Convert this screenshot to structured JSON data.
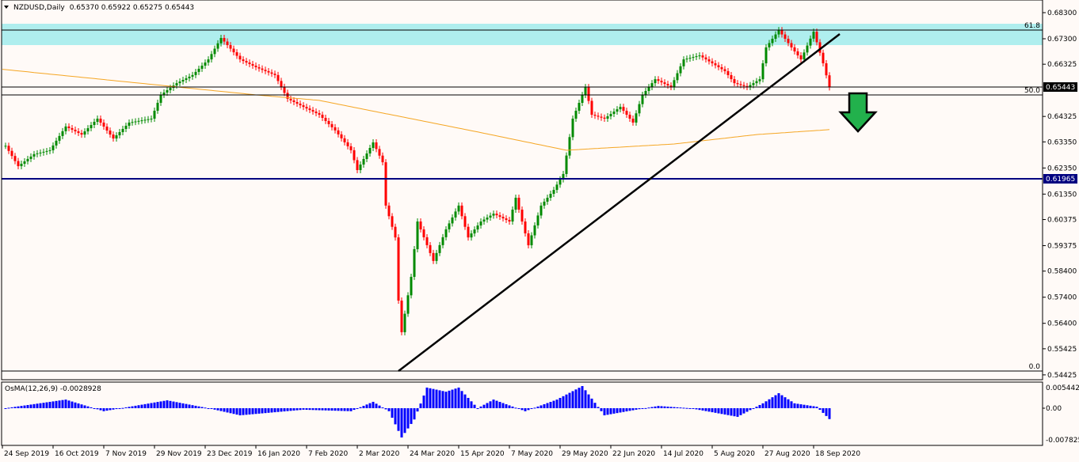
{
  "header": {
    "symbol_timeframe": "NZDUSD,Daily",
    "ohlc": "0.65370 0.65922 0.65275 0.65443"
  },
  "colors": {
    "bull": "#008a00",
    "bear": "#ff0000",
    "ma": "#f5a623",
    "zone": "#afeeee",
    "support": "#000080",
    "histogram": "#0000ff",
    "arrow": "#22b14c",
    "background": "#fffaf7"
  },
  "price_axis": {
    "ticks": [
      "0.68300",
      "0.67300",
      "0.66325",
      "0.64325",
      "0.63350",
      "0.62350",
      "0.61350",
      "0.60375",
      "0.59375",
      "0.58400",
      "0.57400",
      "0.56400",
      "0.55425",
      "0.54425"
    ],
    "current_price": "0.65443",
    "support_price": "0.61965"
  },
  "fibonacci": [
    {
      "label": "61.8",
      "price": 0.6739
    },
    {
      "label": "50.0",
      "price": 0.6515
    },
    {
      "label": "0.0",
      "price": 0.5451
    }
  ],
  "indicator": {
    "title": "OsMA(12,26,9) -0.0028928",
    "axis": [
      "0.0054422",
      "0.00",
      "-0.007825"
    ]
  },
  "time_axis": [
    "24 Sep 2019",
    "16 Oct 2019",
    "7 Nov 2019",
    "29 Nov 2019",
    "23 Dec 2019",
    "16 Jan 2020",
    "7 Feb 2020",
    "2 Mar 2020",
    "24 Mar 2020",
    "15 Apr 2020",
    "7 May 2020",
    "29 May 2020",
    "22 Jun 2020",
    "14 Jul 2020",
    "5 Aug 2020",
    "27 Aug 2020",
    "18 Sep 2020"
  ],
  "chart_data": {
    "type": "candlestick",
    "title": "NZDUSD,Daily",
    "ylim": [
      0.54425,
      0.683
    ],
    "close_keypoints_bar_price": [
      [
        1,
        0.632
      ],
      [
        5,
        0.6242
      ],
      [
        10,
        0.6288
      ],
      [
        15,
        0.6303
      ],
      [
        20,
        0.6394
      ],
      [
        25,
        0.6363
      ],
      [
        30,
        0.6424
      ],
      [
        35,
        0.6348
      ],
      [
        40,
        0.6409
      ],
      [
        47,
        0.6424
      ],
      [
        50,
        0.6515
      ],
      [
        55,
        0.656
      ],
      [
        60,
        0.6591
      ],
      [
        65,
        0.6651
      ],
      [
        69,
        0.6733
      ],
      [
        75,
        0.6651
      ],
      [
        80,
        0.6621
      ],
      [
        86,
        0.6591
      ],
      [
        90,
        0.65
      ],
      [
        95,
        0.6469
      ],
      [
        100,
        0.6439
      ],
      [
        105,
        0.6379
      ],
      [
        110,
        0.6303
      ],
      [
        112,
        0.6227
      ],
      [
        117,
        0.6333
      ],
      [
        120,
        0.6257
      ],
      [
        121,
        0.6091
      ],
      [
        124,
        0.5969
      ],
      [
        125,
        0.5727
      ],
      [
        126,
        0.5606
      ],
      [
        129,
        0.5818
      ],
      [
        131,
        0.603
      ],
      [
        136,
        0.5879
      ],
      [
        140,
        0.6
      ],
      [
        144,
        0.6091
      ],
      [
        147,
        0.5969
      ],
      [
        151,
        0.603
      ],
      [
        155,
        0.606
      ],
      [
        160,
        0.603
      ],
      [
        162,
        0.6121
      ],
      [
        166,
        0.5939
      ],
      [
        170,
        0.6091
      ],
      [
        174,
        0.6151
      ],
      [
        177,
        0.6212
      ],
      [
        180,
        0.6424
      ],
      [
        184,
        0.6545
      ],
      [
        186,
        0.6439
      ],
      [
        190,
        0.6424
      ],
      [
        195,
        0.6469
      ],
      [
        199,
        0.6409
      ],
      [
        202,
        0.6515
      ],
      [
        206,
        0.6575
      ],
      [
        211,
        0.6545
      ],
      [
        215,
        0.6651
      ],
      [
        220,
        0.6666
      ],
      [
        224,
        0.6636
      ],
      [
        228,
        0.6606
      ],
      [
        231,
        0.656
      ],
      [
        235,
        0.6545
      ],
      [
        239,
        0.6575
      ],
      [
        241,
        0.6697
      ],
      [
        245,
        0.6763
      ],
      [
        249,
        0.6697
      ],
      [
        252,
        0.6651
      ],
      [
        256,
        0.6757
      ],
      [
        259,
        0.6636
      ],
      [
        261,
        0.6544
      ]
    ],
    "ma_keypoints_bar_price": [
      [
        0,
        0.6613
      ],
      [
        80,
        0.6515
      ],
      [
        100,
        0.6494
      ],
      [
        150,
        0.6373
      ],
      [
        178,
        0.6303
      ],
      [
        212,
        0.6327
      ],
      [
        238,
        0.6363
      ],
      [
        261,
        0.6382
      ]
    ],
    "trendline": {
      "from": [
        126,
        0.5451
      ],
      "to": [
        265,
        0.6742
      ]
    },
    "horizontal_lines": [
      0.65443,
      0.61965
    ],
    "zone": [
      0.67,
      0.6782
    ],
    "osma_keypoints_bar_value": [
      [
        1,
        0
      ],
      [
        20,
        0.0023
      ],
      [
        32,
        -0.0008
      ],
      [
        52,
        0.0021
      ],
      [
        65,
        0
      ],
      [
        75,
        -0.0019
      ],
      [
        95,
        -0.0004
      ],
      [
        110,
        -0.0008
      ],
      [
        117,
        0.0017
      ],
      [
        122,
        -0.0008
      ],
      [
        126,
        -0.0078
      ],
      [
        130,
        -0.003
      ],
      [
        134,
        0.0055
      ],
      [
        140,
        0.0044
      ],
      [
        144,
        0.0055
      ],
      [
        150,
        0
      ],
      [
        155,
        0.0023
      ],
      [
        165,
        -0.0008
      ],
      [
        175,
        0.0023
      ],
      [
        183,
        0.0059
      ],
      [
        190,
        -0.0019
      ],
      [
        200,
        -0.0004
      ],
      [
        207,
        0.0006
      ],
      [
        217,
        0
      ],
      [
        232,
        -0.0023
      ],
      [
        240,
        0.0013
      ],
      [
        245,
        0.004
      ],
      [
        250,
        0.0013
      ],
      [
        257,
        0.0004
      ],
      [
        261,
        -0.0029
      ]
    ]
  }
}
